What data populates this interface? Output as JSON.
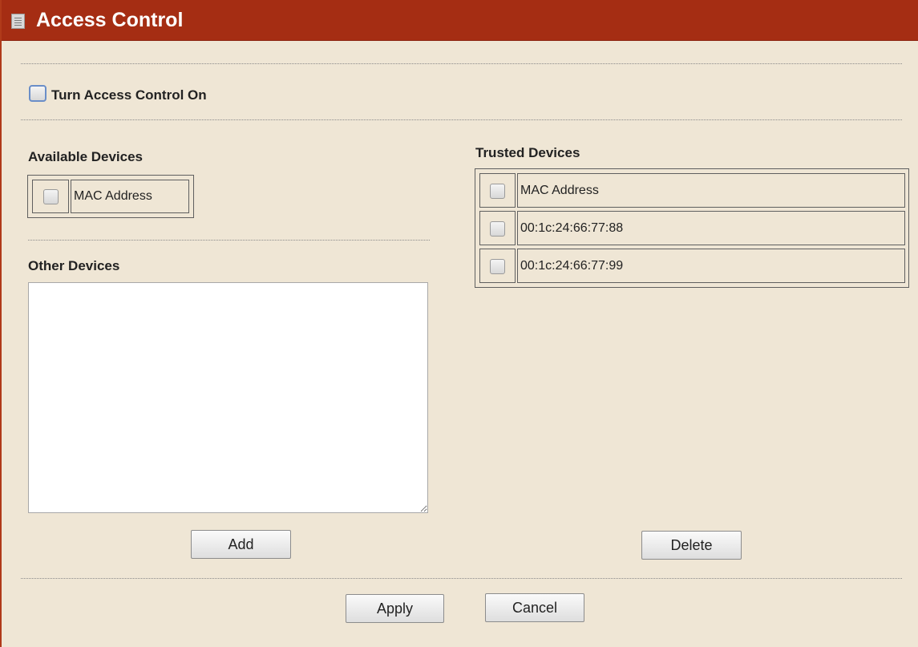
{
  "header": {
    "title": "Access Control",
    "icon": "document-list-icon",
    "background": "#a52d13"
  },
  "toggle": {
    "label": "Turn Access Control On",
    "checked": false
  },
  "available_devices": {
    "heading": "Available Devices",
    "table_header": "MAC Address",
    "rows": []
  },
  "other_devices": {
    "heading": "Other Devices",
    "value": ""
  },
  "trusted_devices": {
    "heading": "Trusted Devices",
    "table_header": "MAC Address",
    "rows": [
      {
        "mac": "00:1c:24:66:77:88",
        "checked": false
      },
      {
        "mac": "00:1c:24:66:77:99",
        "checked": false
      }
    ]
  },
  "buttons": {
    "add": "Add",
    "delete": "Delete",
    "apply": "Apply",
    "cancel": "Cancel"
  },
  "colors": {
    "page_background": "#efe6d5",
    "header_background": "#a52d13",
    "header_text": "#ffffff"
  }
}
